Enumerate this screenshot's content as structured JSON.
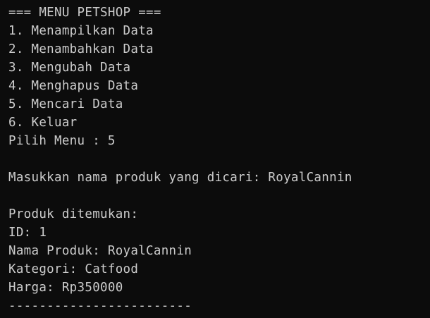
{
  "terminal": {
    "menu": {
      "header": "=== MENU PETSHOP ===",
      "items": [
        "1. Menampilkan Data",
        "2. Menambahkan Data",
        "3. Mengubah Data",
        "4. Menghapus Data",
        "5. Mencari Data",
        "6. Keluar"
      ],
      "prompt": "Pilih Menu : 5"
    },
    "search_prompt": "Masukkan nama produk yang dicari: RoyalCannin",
    "result": {
      "heading": "Produk ditemukan:",
      "id": "ID: 1",
      "name": "Nama Produk: RoyalCannin",
      "category": "Kategori: Catfood",
      "price": "Harga: Rp350000",
      "separator": "------------------------"
    }
  }
}
